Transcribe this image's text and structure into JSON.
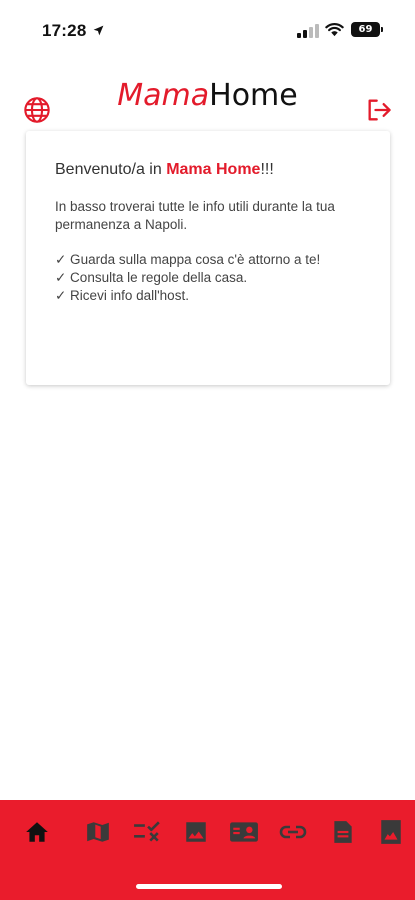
{
  "status_bar": {
    "time": "17:28",
    "battery": "69"
  },
  "header": {
    "logo_part1": "Mama",
    "logo_part2": "Home",
    "brand_color": "#e31b2b",
    "left_icon": "globe-icon",
    "right_icon": "logout-icon"
  },
  "card": {
    "title_prefix": "Benvenuto/a in ",
    "title_brand": "Mama Home",
    "title_suffix": "!!!",
    "intro": "In basso troverai tutte le info utili durante la tua permanenza a Napoli.",
    "features": [
      "✓ Guarda sulla mappa cosa c'è attorno a te!",
      "✓ Consulta le regole della casa.",
      "✓ Ricevi info dall'host."
    ]
  },
  "bottom_nav": {
    "background": "#ea1c2c",
    "items": [
      {
        "icon": "home-icon",
        "active": true
      },
      {
        "icon": "map-icon",
        "active": false
      },
      {
        "icon": "rules-checklist-icon",
        "active": false
      },
      {
        "icon": "image-icon",
        "active": false
      },
      {
        "icon": "contact-card-icon",
        "active": false
      },
      {
        "icon": "link-icon",
        "active": false
      },
      {
        "icon": "document-icon",
        "active": false
      },
      {
        "icon": "photo-portrait-icon",
        "active": false
      }
    ]
  }
}
